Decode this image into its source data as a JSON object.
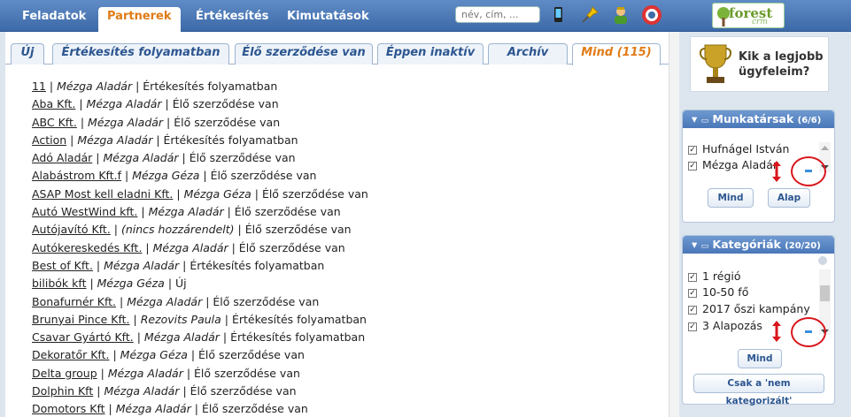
{
  "nav": {
    "tabs": [
      "Feladatok",
      "Partnerek",
      "Értékesítés",
      "Kimutatások"
    ],
    "active": "Partnerek",
    "search_placeholder": "név, cím, ...",
    "logo_text": "forest",
    "logo_sub": "crm"
  },
  "filter_tabs": [
    "Új",
    "Értékesítés folyamatban",
    "Élő szerződése van",
    "Éppen inaktív",
    "Archív",
    "Mind (115)"
  ],
  "partners": [
    {
      "name": "11",
      "owner": "Mézga Aladár",
      "status": "Értékesítés folyamatban"
    },
    {
      "name": "Aba Kft.",
      "owner": "Mézga Aladár",
      "status": "Élő szerződése van"
    },
    {
      "name": "ABC Kft.",
      "owner": "Mézga Aladár",
      "status": "Élő szerződése van"
    },
    {
      "name": "Action",
      "owner": "Mézga Aladár",
      "status": "Értékesítés folyamatban"
    },
    {
      "name": "Adó Aladár",
      "owner": "Mézga Aladár",
      "status": "Élő szerződése van"
    },
    {
      "name": "Alabástrom Kft.f",
      "owner": "Mézga Géza",
      "status": "Élő szerződése van"
    },
    {
      "name": "ASAP Most kell eladni Kft.",
      "owner": "Mézga Géza",
      "status": "Élő szerződése van"
    },
    {
      "name": "Autó WestWind kft.",
      "owner": "Mézga Aladár",
      "status": "Élő szerződése van"
    },
    {
      "name": "Autójavító Kft.",
      "owner": "(nincs hozzárendelt)",
      "status": "Élő szerződése van"
    },
    {
      "name": "Autókereskedés Kft.",
      "owner": "Mézga Aladár",
      "status": "Élő szerződése van"
    },
    {
      "name": "Best of Kft.",
      "owner": "Mézga Aladár",
      "status": "Értékesítés folyamatban"
    },
    {
      "name": "bilibók kft",
      "owner": "Mézga Géza",
      "status": "Új"
    },
    {
      "name": "Bonafurnér Kft.",
      "owner": "Mézga Aladár",
      "status": "Élő szerződése van"
    },
    {
      "name": "Brunyai Pince Kft.",
      "owner": "Rezovits Paula",
      "status": "Értékesítés folyamatban"
    },
    {
      "name": "Csavar Gyártó Kft.",
      "owner": "Mézga Aladár",
      "status": "Értékesítés folyamatban"
    },
    {
      "name": "Dekoratőr Kft.",
      "owner": "Mézga Géza",
      "status": "Élő szerződése van"
    },
    {
      "name": "Delta group",
      "owner": "Mézga Aladár",
      "status": "Élő szerződése van"
    },
    {
      "name": "Dolphin Kft",
      "owner": "Mézga Aladár",
      "status": "Élő szerződése van"
    },
    {
      "name": "Domotors Kft",
      "owner": "Mézga Aladár",
      "status": "Élő szerződése van"
    }
  ],
  "promo": {
    "line1": "Kik a legjobb",
    "line2": "ügyfeleim?"
  },
  "workers": {
    "title": "Munkatársak",
    "count": "(6/6)",
    "items": [
      "Hufnágel István",
      "Mézga Aladár"
    ],
    "btn_all": "Mind",
    "btn_default": "Alap"
  },
  "categories": {
    "title": "Kategóriák",
    "count": "(20/20)",
    "items": [
      "1 régió",
      "10-50 fő",
      "2017 őszi kampány",
      "3 Alapozás"
    ],
    "btn_all": "Mind",
    "btn_uncat": "Csak a 'nem kategorizált'"
  },
  "colors": {
    "nav": "#3d6aa8",
    "active": "#e07b16",
    "highlight": "#d9161c"
  }
}
